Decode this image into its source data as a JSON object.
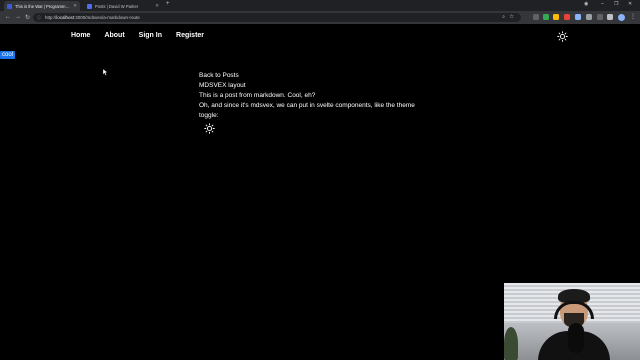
{
  "browser": {
    "tabs": [
      {
        "title": "This is the Wat | Programming w...",
        "active": true,
        "favicon_color": "#3b5bdb"
      },
      {
        "title": "Posts | David W Parker",
        "active": false,
        "favicon_color": "#4c6ef5"
      }
    ],
    "new_tab_symbol": "+",
    "window_controls": {
      "minimize": "–",
      "maximize": "❐",
      "close": "✕"
    },
    "url": {
      "scheme": "http://",
      "host": "localhost",
      "rest": ":3000/mdsvex/a-markdown-route"
    },
    "nav_symbols": {
      "back": "←",
      "forward": "→",
      "reload": "↻"
    },
    "star_symbol": "☆",
    "menu_symbol": "⋮",
    "extension_colors": [
      "#5f6368",
      "#34a853",
      "#fbbc04",
      "#ea4335",
      "#8ab4f8",
      "#9aa0a6",
      "#5f6368",
      "#bdc1c6"
    ]
  },
  "page": {
    "nav": [
      "Home",
      "About",
      "Sign In",
      "Register"
    ],
    "badge": "cool",
    "content": {
      "back_link": "Back to Posts",
      "heading": "MDSVEX layout",
      "line1": "This is a post from markdown. Cool, eh?",
      "line2": "Oh, and since it's mdsvex, we can put in svelte components, like the theme toggle:"
    },
    "theme_icon": "sun-icon"
  },
  "colors": {
    "page_background": "#000000",
    "text": "#ffffff",
    "badge_background": "#1a73e8",
    "chrome_dark": "#202124",
    "chrome_toolbar": "#35363a"
  }
}
